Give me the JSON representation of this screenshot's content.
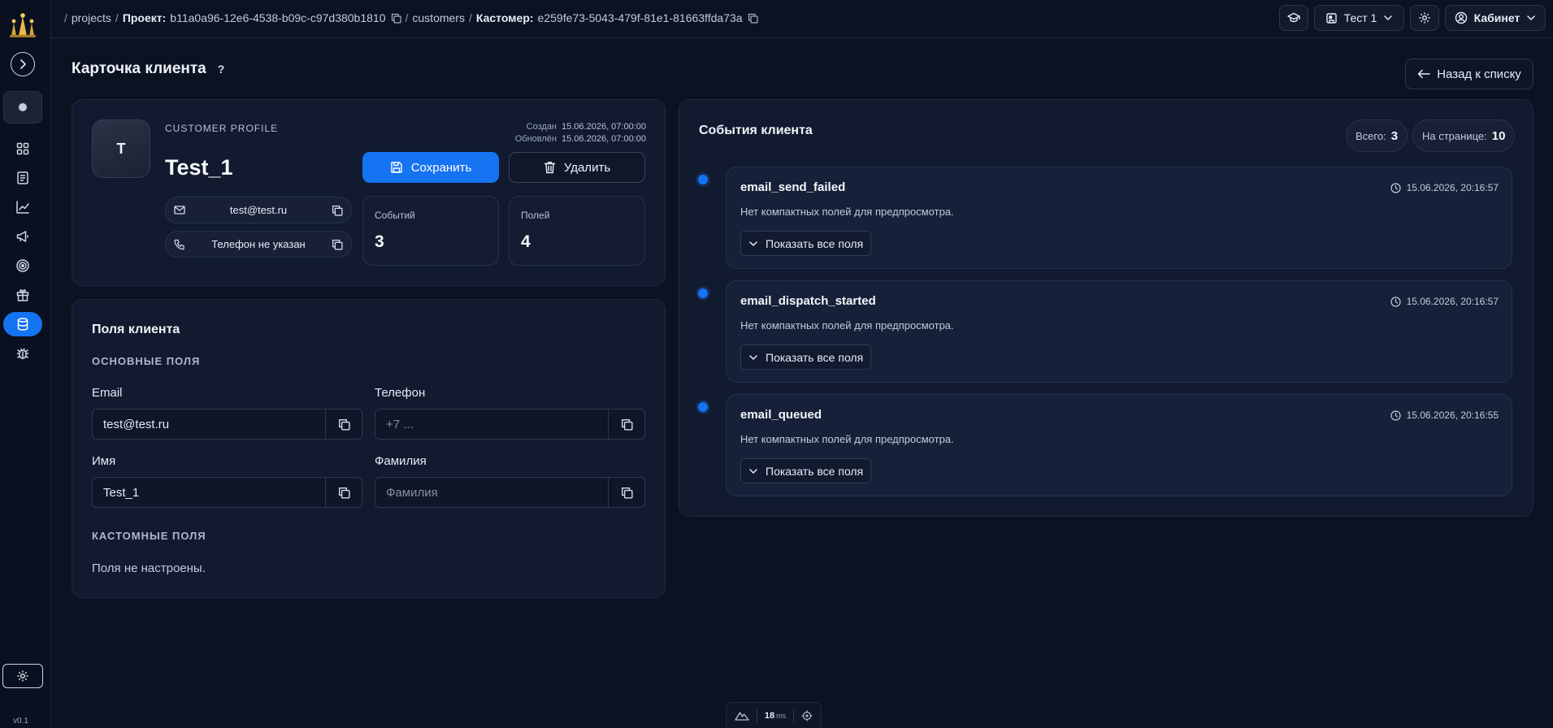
{
  "app": {
    "version": "v0.1"
  },
  "breadcrumb": {
    "projects": "projects",
    "project_label": "Проект:",
    "project_id": "b11a0a96-12e6-4538-b09c-c97d380b1810",
    "customers": "customers",
    "customer_label": "Кастомер:",
    "customer_id": "e259fe73-5043-479f-81e1-81663ffda73a"
  },
  "topbar": {
    "project_select": "Тест 1",
    "account": "Кабинет"
  },
  "page": {
    "title": "Карточка клиента",
    "help": "?",
    "back": "Назад к списку"
  },
  "profile": {
    "avatar_letter": "T",
    "kicker": "CUSTOMER PROFILE",
    "name": "Test_1",
    "created_label": "Создан",
    "created_value": "15.06.2026, 07:00:00",
    "updated_label": "Обновлён",
    "updated_value": "15.06.2026, 07:00:00",
    "save": "Сохранить",
    "delete": "Удалить",
    "email": "test@test.ru",
    "phone": "Телефон не указан",
    "stats": [
      {
        "label": "Событий",
        "value": "3"
      },
      {
        "label": "Полей",
        "value": "4"
      }
    ]
  },
  "fields": {
    "title": "Поля клиента",
    "basic_title": "ОСНОВНЫЕ ПОЛЯ",
    "email_label": "Email",
    "email_value": "test@test.ru",
    "phone_label": "Телефон",
    "phone_placeholder": "+7 ...",
    "first_label": "Имя",
    "first_value": "Test_1",
    "last_label": "Фамилия",
    "last_placeholder": "Фамилия",
    "custom_title": "КАСТОМНЫЕ ПОЛЯ",
    "custom_empty": "Поля не настроены."
  },
  "events": {
    "title": "События клиента",
    "total_label": "Всего:",
    "total_value": "3",
    "per_page_label": "На странице:",
    "per_page_value": "10",
    "items": [
      {
        "name": "email_send_failed",
        "desc": "Нет компактных полей для предпросмотра.",
        "time": "15.06.2026, 20:16:57",
        "expand": "Показать все поля"
      },
      {
        "name": "email_dispatch_started",
        "desc": "Нет компактных полей для предпросмотра.",
        "time": "15.06.2026, 20:16:57",
        "expand": "Показать все поля"
      },
      {
        "name": "email_queued",
        "desc": "Нет компактных полей для предпросмотра.",
        "time": "15.06.2026, 20:16:55",
        "expand": "Показать все поля"
      }
    ]
  },
  "perf": {
    "value": "18",
    "unit": "ms"
  },
  "colors": {
    "accent": "#1673f2",
    "background": "#0b1222",
    "card": "#111a2e"
  }
}
